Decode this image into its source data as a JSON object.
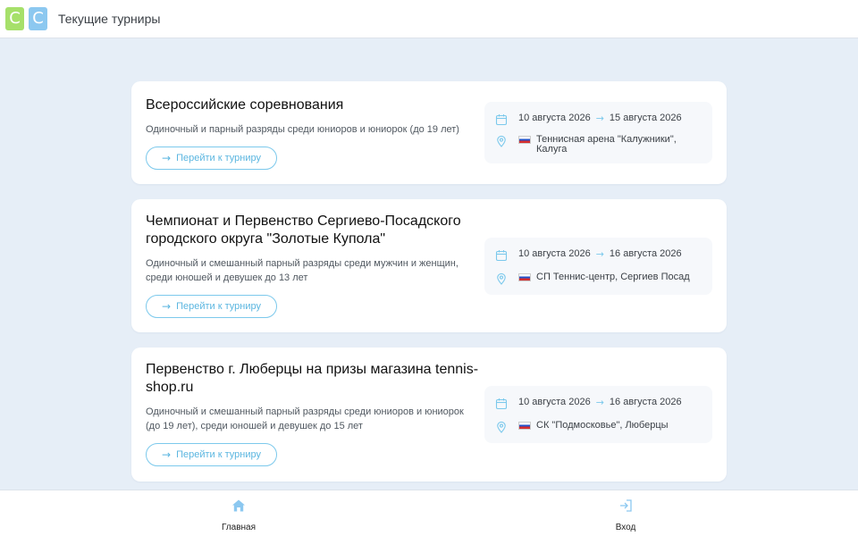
{
  "header": {
    "logo_letters": [
      "C",
      "C"
    ],
    "title": "Текущие турниры"
  },
  "tournaments": [
    {
      "title": "Всероссийские соревнования",
      "description": "Одиночный и парный разряды среди юниоров и юниорок (до 19 лет)",
      "button_label": "Перейти к турниру",
      "start_date": "10 августа 2026",
      "end_date": "15 августа 2026",
      "location": "Теннисная арена \"Калужники\", Калуга"
    },
    {
      "title": "Чемпионат и Первенство Сергиево-Посадского городского округа \"Золотые Купола\"",
      "description": "Одиночный и смешанный парный разряды среди мужчин и женщин, среди юношей и девушек до 13 лет",
      "button_label": "Перейти к турниру",
      "start_date": "10 августа 2026",
      "end_date": "16 августа 2026",
      "location": "СП Теннис-центр, Сергиев Посад"
    },
    {
      "title": "Первенство г. Люберцы на призы магазина tennis-shop.ru",
      "description": "Одиночный и смешанный парный разряды среди юниоров и юниорок (до 19 лет), среди юношей и девушек до 15 лет",
      "button_label": "Перейти к турниру",
      "start_date": "10 августа 2026",
      "end_date": "16 августа 2026",
      "location": "СК \"Подмосковье\", Люберцы"
    }
  ],
  "bottom_nav": {
    "home_label": "Главная",
    "home_icon": "home-icon",
    "login_label": "Вход",
    "login_icon": "login-icon"
  },
  "colors": {
    "accent": "#5bb6e0",
    "background": "#e6eef7",
    "logo_green": "#a6e06a",
    "logo_blue": "#8cc8f0"
  }
}
